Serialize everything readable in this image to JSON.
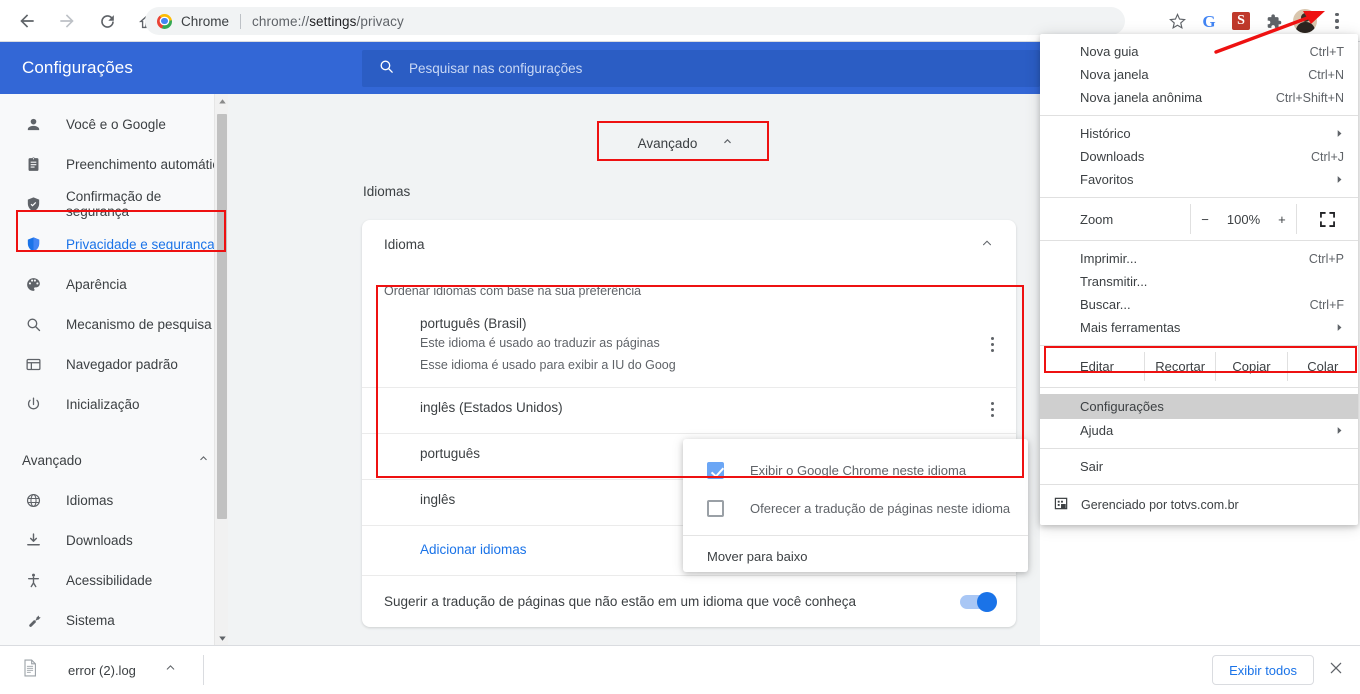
{
  "browser": {
    "nav": {
      "back": "back-arrow",
      "forward": "forward-arrow",
      "reload": "reload",
      "home": "home"
    },
    "omnibox": {
      "site_label": "Chrome",
      "url_prefix": "chrome://",
      "url_bold": "settings",
      "url_suffix": "/privacy"
    },
    "toolbar_icons": [
      "bookmark-star",
      "google",
      "grammarly",
      "extensions",
      "profile-avatar",
      "chrome-menu"
    ]
  },
  "settings": {
    "title": "Configurações",
    "search_placeholder": "Pesquisar nas configurações",
    "search_value": ""
  },
  "sidebar": {
    "items": [
      {
        "label": "Você e o Google",
        "icon": "person-icon"
      },
      {
        "label": "Preenchimento automático",
        "icon": "clipboard-icon"
      },
      {
        "label": "Confirmação de segurança",
        "icon": "shield-check-icon"
      },
      {
        "label": "Privacidade e segurança",
        "icon": "shield-icon",
        "active": true
      },
      {
        "label": "Aparência",
        "icon": "palette-icon"
      },
      {
        "label": "Mecanismo de pesquisa",
        "icon": "search-icon"
      },
      {
        "label": "Navegador padrão",
        "icon": "browser-window-icon"
      },
      {
        "label": "Inicialização",
        "icon": "power-icon"
      }
    ],
    "advanced_group": "Avançado",
    "advanced_items": [
      {
        "label": "Idiomas",
        "icon": "globe-icon"
      },
      {
        "label": "Downloads",
        "icon": "download-icon"
      },
      {
        "label": "Acessibilidade",
        "icon": "accessibility-icon"
      },
      {
        "label": "Sistema",
        "icon": "wrench-icon"
      }
    ]
  },
  "main": {
    "advanced_button": "Avançado",
    "section_title": "Idiomas",
    "card_title": "Idioma",
    "order_hint": "Ordenar idiomas com base na sua preferência",
    "languages": [
      {
        "name": "português (Brasil)",
        "desc1": "Este idioma é usado ao traduzir as páginas",
        "desc2": "Esse idioma é usado para exibir a IU do Goog"
      },
      {
        "name": "inglês (Estados Unidos)",
        "desc1": "",
        "desc2": ""
      },
      {
        "name": "português",
        "desc1": "",
        "desc2": ""
      },
      {
        "name": "inglês",
        "desc1": "",
        "desc2": ""
      }
    ],
    "add_language": "Adicionar idiomas",
    "suggest_label": "Sugerir a tradução de páginas que não estão em um idioma que você conheça",
    "suggest_enabled": true
  },
  "context_menu": {
    "options": [
      {
        "label": "Exibir o Google Chrome neste idioma",
        "checked": true
      },
      {
        "label": "Oferecer a tradução de páginas neste idioma",
        "checked": false
      }
    ],
    "action": "Mover para baixo"
  },
  "app_menu": {
    "group1": [
      {
        "label": "Nova guia",
        "accel": "Ctrl+T"
      },
      {
        "label": "Nova janela",
        "accel": "Ctrl+N"
      },
      {
        "label": "Nova janela anônima",
        "accel": "Ctrl+Shift+N"
      }
    ],
    "group2": [
      {
        "label": "Histórico",
        "accel": "",
        "submenu": true
      },
      {
        "label": "Downloads",
        "accel": "Ctrl+J",
        "submenu": false
      },
      {
        "label": "Favoritos",
        "accel": "",
        "submenu": true
      }
    ],
    "zoom": {
      "label": "Zoom",
      "minus": "−",
      "value": "100%",
      "plus": "+",
      "fullscreen": "fullscreen-icon"
    },
    "group3": [
      {
        "label": "Imprimir...",
        "accel": "Ctrl+P",
        "submenu": false
      },
      {
        "label": "Transmitir...",
        "accel": "",
        "submenu": false
      },
      {
        "label": "Buscar...",
        "accel": "Ctrl+F",
        "submenu": false
      },
      {
        "label": "Mais ferramentas",
        "accel": "",
        "submenu": true
      }
    ],
    "edit_row": [
      "Editar",
      "Recortar",
      "Copiar",
      "Colar"
    ],
    "group4": [
      {
        "label": "Configurações",
        "accel": "",
        "submenu": false,
        "highlighted": true
      },
      {
        "label": "Ajuda",
        "accel": "",
        "submenu": true
      }
    ],
    "exit": "Sair",
    "managed": "Gerenciado por totvs.com.br"
  },
  "downloads_bar": {
    "file_name": "error (2).log",
    "show_all": "Exibir todos",
    "close": "close-icon"
  },
  "colors": {
    "header_blue": "#3367d6",
    "accent_blue": "#1a73e8",
    "annotation_red": "#ee1111",
    "page_bg": "#f1f3f4"
  }
}
